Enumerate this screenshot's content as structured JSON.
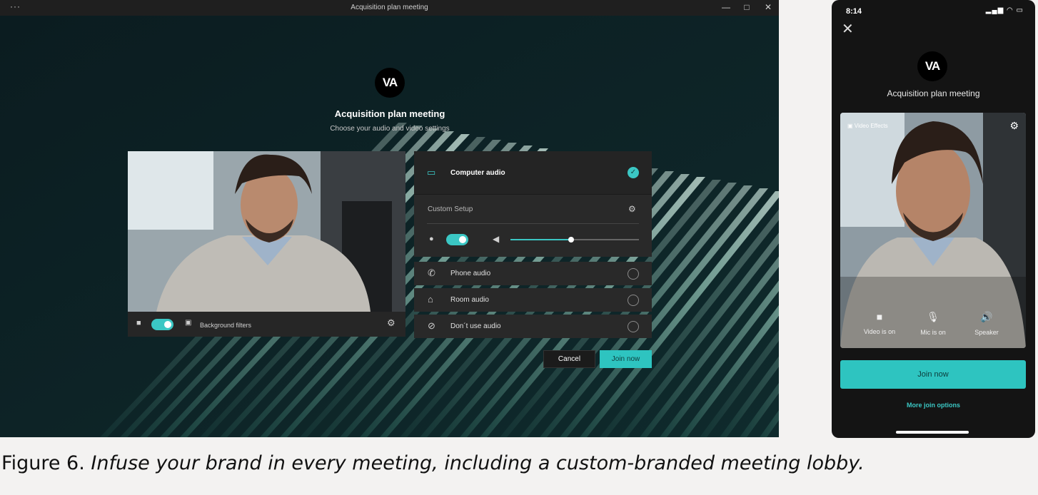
{
  "window": {
    "title": "Acquisition plan meeting",
    "menu_glyph": "···",
    "minimize_glyph": "—",
    "maximize_glyph": "□",
    "close_glyph": "✕"
  },
  "lobby": {
    "logo_text": "VA",
    "meeting_title": "Acquisition plan meeting",
    "subtitle": "Choose your audio and video settings",
    "background_filters_label": "Background filters",
    "audio": {
      "computer_audio_label": "Computer audio",
      "custom_setup_label": "Custom Setup",
      "options": [
        {
          "label": "Phone audio",
          "icon": "phone-icon"
        },
        {
          "label": "Room audio",
          "icon": "room-icon"
        },
        {
          "label": "Don´t use audio",
          "icon": "no-audio-icon"
        }
      ],
      "speaker_volume_fraction": 0.47
    },
    "cancel_label": "Cancel",
    "join_label": "Join now"
  },
  "phone": {
    "time": "8:14",
    "status_icons": "▂▄▆ ◠ ▭",
    "close_glyph": "✕",
    "logo_text": "VA",
    "meeting_title": "Acquisition plan meeting",
    "video_effects_label": "Video Effects",
    "controls": [
      {
        "label": "Video is on",
        "icon": "camera-icon",
        "glyph": "■"
      },
      {
        "label": "Mic is on",
        "icon": "mic-icon",
        "glyph": "🎙"
      },
      {
        "label": "Speaker",
        "icon": "speaker-icon",
        "glyph": "🔊"
      }
    ],
    "join_label": "Join now",
    "more_options_label": "More join options"
  },
  "caption": {
    "prefix": "Figure 6. ",
    "text": "Infuse your brand in every meeting, including a custom-branded meeting lobby."
  },
  "colors": {
    "accent": "#2ec4c0",
    "background": "#0a1a1e"
  }
}
